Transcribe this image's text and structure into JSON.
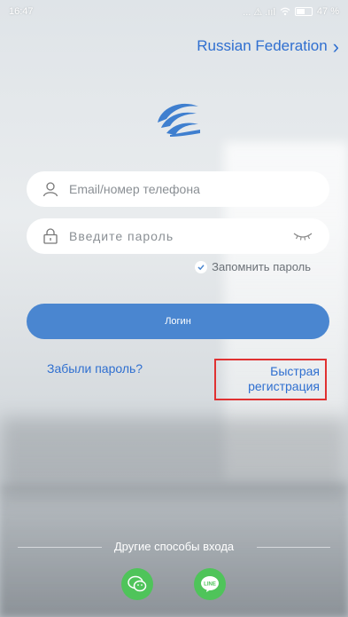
{
  "status_bar": {
    "time": "16:47",
    "signal_text": "... ⚠ .ııl",
    "battery": "47 %"
  },
  "region": {
    "label": "Russian Federation",
    "icon": "chevron-right-icon"
  },
  "email": {
    "placeholder": "Email/номер телефона",
    "icon": "user-icon"
  },
  "password": {
    "placeholder": "Введите пароль",
    "icon": "lock-icon",
    "toggle_icon": "eye-closed-icon"
  },
  "remember": {
    "label": "Запомнить пароль",
    "checked": true
  },
  "login": {
    "label": "Логин"
  },
  "links": {
    "forgot": "Забыли пароль?",
    "quick_register_line1": "Быстрая",
    "quick_register_line2": "регистрация"
  },
  "other": {
    "label": "Другие способы входа",
    "wechat_icon": "wechat-icon",
    "line_icon": "line-icon"
  },
  "colors": {
    "accent": "#2f6fd0",
    "button": "#4a86d0",
    "highlight": "#e03131",
    "social": "#4fc45a"
  }
}
